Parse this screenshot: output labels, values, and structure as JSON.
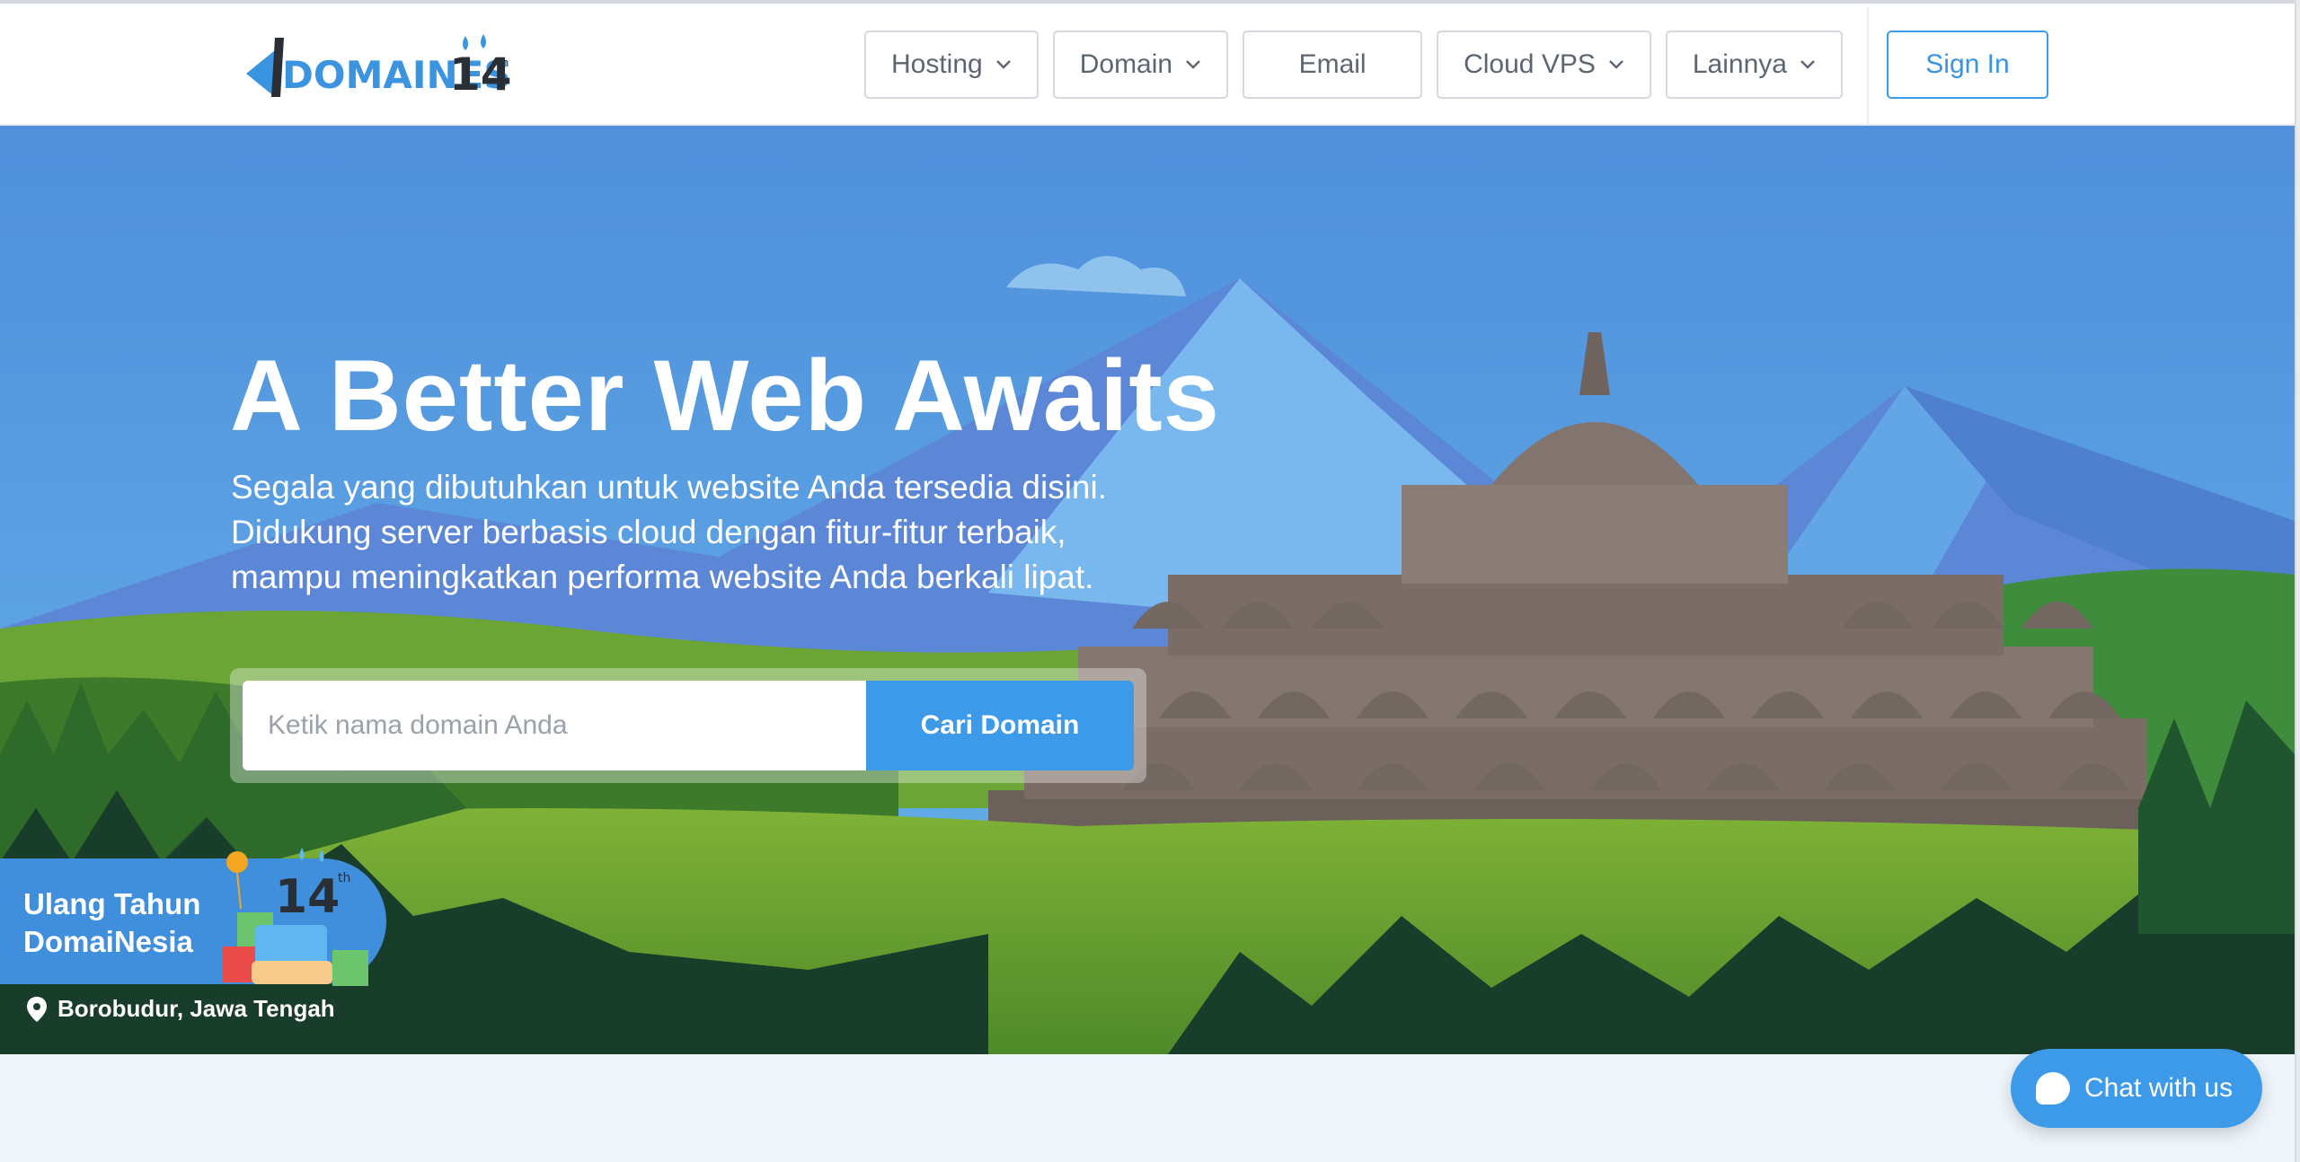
{
  "header": {
    "logo": {
      "text": "DOMAINESIA",
      "number": "14",
      "suffix": "th"
    },
    "nav": [
      {
        "label": "Hosting",
        "has_dropdown": true
      },
      {
        "label": "Domain",
        "has_dropdown": true
      },
      {
        "label": "Email",
        "has_dropdown": false
      },
      {
        "label": "Cloud VPS",
        "has_dropdown": true
      },
      {
        "label": "Lainnya",
        "has_dropdown": true
      }
    ],
    "signin_label": "Sign In"
  },
  "hero": {
    "title": "A Better Web Awaits",
    "subtitle_lines": [
      "Segala yang dibutuhkan untuk website Anda tersedia disini.",
      "Didukung server berbasis cloud dengan fitur-fitur terbaik,",
      "mampu meningkatkan performa website Anda berkali lipat."
    ],
    "search": {
      "placeholder": "Ketik nama domain Anda",
      "value": "",
      "button_label": "Cari Domain"
    },
    "anniversary": {
      "line1": "Ulang Tahun",
      "line2": "DomaiNesia",
      "badge_number": "14",
      "badge_suffix": "th"
    },
    "location": "Borobudur, Jawa Tengah"
  },
  "chat": {
    "label": "Chat with us"
  },
  "colors": {
    "accent": "#3d9ae8",
    "sky": "#5294dc",
    "forest_dark": "#183d2a",
    "temple": "#7b6d66",
    "below_bg": "#eef5fb"
  },
  "icons": {
    "chevron": "chevron-down-icon",
    "location": "map-pin-icon",
    "chat": "chat-bubble-icon"
  }
}
